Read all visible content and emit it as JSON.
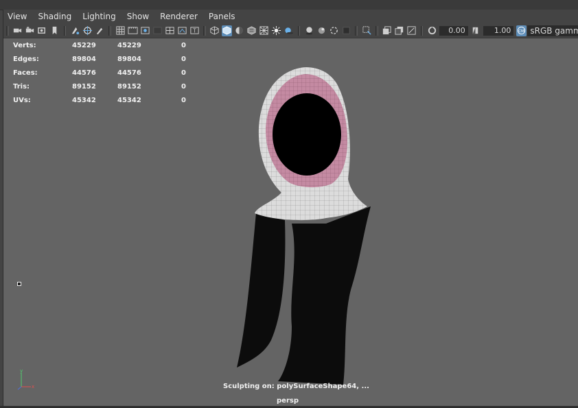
{
  "menubar": {
    "items": [
      "View",
      "Shading",
      "Lighting",
      "Show",
      "Renderer",
      "Panels"
    ]
  },
  "toolbar": {
    "icons": [
      "camera-icon",
      "camera-attributes-icon",
      "bookmark-icon",
      "image-plane-icon",
      "grid-icon",
      "film-gate-icon",
      "resolution-gate-icon",
      "gate-mask-icon",
      "field-chart-icon",
      "safe-action-icon",
      "safe-title-icon",
      "wireframe-icon",
      "smooth-shade-icon",
      "default-lighting-icon",
      "textured-icon",
      "use-lights-icon",
      "shadows-icon",
      "ambient-occlusion-icon",
      "motion-blur-icon",
      "anti-aliasing-icon",
      "depth-of-field-icon",
      "isolate-select-icon",
      "xray-icon",
      "xray-joints-icon",
      "xray-active-icon",
      "exposure-icon",
      "gamma-icon",
      "color-management-icon"
    ],
    "exposure_value": "0.00",
    "gamma_value": "1.00",
    "color_space": "sRGB gamma"
  },
  "hud": {
    "rows": [
      {
        "label": "Verts:",
        "v1": "45229",
        "v2": "45229",
        "v3": "0"
      },
      {
        "label": "Edges:",
        "v1": "89804",
        "v2": "89804",
        "v3": "0"
      },
      {
        "label": "Faces:",
        "v1": "44576",
        "v2": "44576",
        "v3": "0"
      },
      {
        "label": "Tris:",
        "v1": "89152",
        "v2": "89152",
        "v3": "0"
      },
      {
        "label": "UVs:",
        "v1": "45342",
        "v2": "45342",
        "v3": "0"
      }
    ]
  },
  "viewport": {
    "sculpt_status": "Sculpting on: polySurfaceShape64, ...",
    "camera_name": "persp",
    "axis_labels": {
      "x": "x",
      "y": "y"
    }
  },
  "colors": {
    "viewport_bg": "#646464",
    "panel_bg": "#444444",
    "active_icon": "#5d8db8",
    "hood_inner": "#c48aa2",
    "cloth_white": "#dcdcdc",
    "cloth_dark": "#0c0c0c",
    "axis_x": "#e05050",
    "axis_y": "#50d070",
    "axis_z": "#5070e0"
  }
}
